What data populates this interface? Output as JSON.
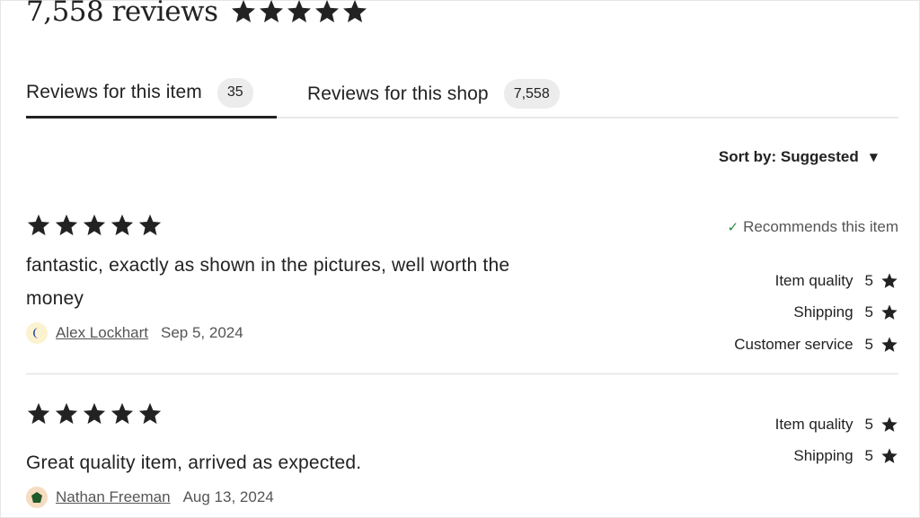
{
  "header": {
    "review_count": "7,558 reviews",
    "overall_stars": 5
  },
  "tabs": [
    {
      "label": "Reviews for this item",
      "count": "35",
      "active": true
    },
    {
      "label": "Reviews for this shop",
      "count": "7,558",
      "active": false
    }
  ],
  "sort": {
    "label": "Sort by: Suggested"
  },
  "reviews": [
    {
      "stars": 5,
      "text": "fantastic, exactly as shown in the pictures, well worth the money",
      "author": "Alex Lockhart",
      "date": "Sep 5, 2024",
      "recommends": "Recommends this item",
      "ratings": [
        {
          "label": "Item quality",
          "value": "5"
        },
        {
          "label": "Shipping",
          "value": "5"
        },
        {
          "label": "Customer service",
          "value": "5"
        }
      ]
    },
    {
      "stars": 5,
      "text": "Great quality item, arrived as expected.",
      "author": "Nathan Freeman",
      "date": "Aug 13, 2024",
      "ratings": [
        {
          "label": "Item quality",
          "value": "5"
        },
        {
          "label": "Shipping",
          "value": "5"
        }
      ]
    }
  ],
  "colors": {
    "text": "#222222",
    "muted": "#555555",
    "badge_bg": "#ececec",
    "check": "#2b8a3e",
    "avatar_1_bg": "#fbf3cf",
    "avatar_1_fg": "#1f3fae",
    "avatar_2_bg": "#f6dcc0",
    "avatar_2_fg": "#1f5a2a"
  },
  "icons": {
    "star": "star-icon",
    "check": "check-icon",
    "caret": "caret-down-icon"
  }
}
